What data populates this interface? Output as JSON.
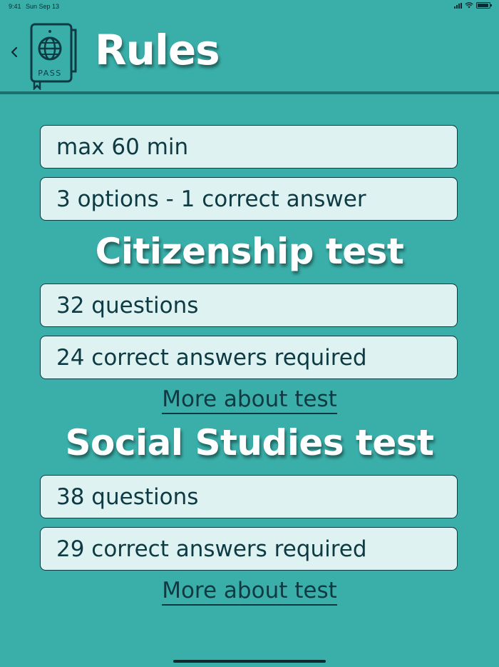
{
  "status_bar": {
    "time": "9:41",
    "date": "Sun Sep 13"
  },
  "header": {
    "title": "Rules",
    "logo_text": "PASS"
  },
  "general_rules": [
    "max 60 min",
    "3 options - 1 correct answer"
  ],
  "citizenship": {
    "title": "Citizenship test",
    "items": [
      "32 questions",
      "24 correct answers required"
    ],
    "more_label": "More about test"
  },
  "social_studies": {
    "title": "Social Studies test",
    "items": [
      "38 questions",
      "29 correct answers required"
    ],
    "more_label": "More about test"
  },
  "colors": {
    "background": "#3aafa9",
    "card": "#def2f1",
    "text_dark": "#0e3b43",
    "divider": "#1b6e6c"
  }
}
